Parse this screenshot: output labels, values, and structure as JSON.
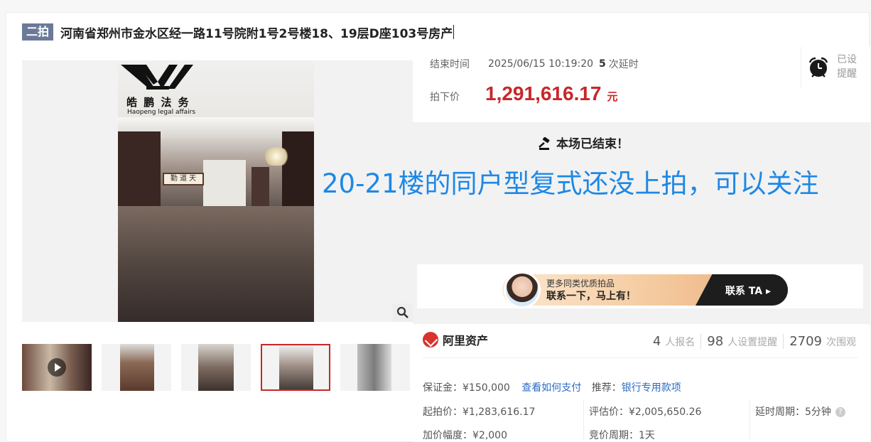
{
  "header": {
    "badge": "二拍",
    "title": "河南省郑州市金水区经一路11号院附1号2号楼18、19层D座103号房产"
  },
  "gallery": {
    "logo_cn": "皓 鹏 法 务",
    "logo_en": "Haopeng legal affairs",
    "sign_text": "勤 道 天",
    "zoom_icon": "magnifier-icon",
    "thumbnails": 5,
    "active_thumbnail": 4
  },
  "auction": {
    "end_label": "结束时间",
    "end_time": "2025/06/15 10:19:20",
    "delay_count": "5",
    "delay_suffix": "次延时",
    "deal_label": "拍下价",
    "deal_price": "1,291,616.17",
    "deal_unit": "元",
    "remind_line1": "已设",
    "remind_line2": "提醒",
    "ended_text": "本场已结束！",
    "overlay_note": "20-21楼的同户型复式还没上拍，可以关注"
  },
  "promo": {
    "line1": "更多同类优质拍品",
    "line2": "联系一下，马上有！",
    "cta": "联系 TA"
  },
  "platform": {
    "name": "阿里资产",
    "stats": [
      {
        "n": "4",
        "label": "人报名"
      },
      {
        "n": "98",
        "label": "人设置提醒"
      },
      {
        "n": "2709",
        "label": "次围观"
      }
    ]
  },
  "details": {
    "deposit_label": "保证金：",
    "deposit_value": "¥150,000",
    "pay_link": "查看如何支付",
    "recommend_label": "推荐：",
    "recommend_link": "银行专用款项",
    "start_label": "起拍价：",
    "start_value": "¥1,283,616.17",
    "eval_label": "评估价：",
    "eval_value": "¥2,005,650.26",
    "delay_period_label": "延时周期：",
    "delay_period_value": "5分钟",
    "increment_label": "加价幅度：",
    "increment_value": "¥2,000",
    "bid_period_label": "竞价周期：",
    "bid_period_value": "1天"
  },
  "colors": {
    "accent_red": "#c8272a",
    "link_blue": "#2b6bc4",
    "overlay_blue": "#1e88e5",
    "badge_gray": "#6b7a99"
  }
}
